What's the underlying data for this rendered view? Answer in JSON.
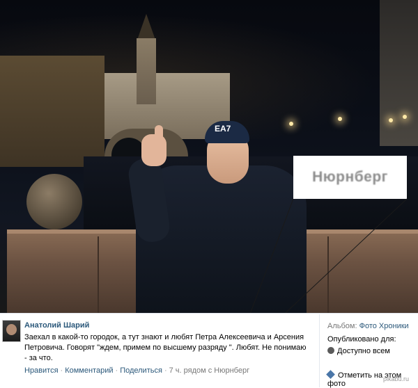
{
  "photo": {
    "caption_box": "Нюрнберг",
    "cap_logo": "EA7"
  },
  "post": {
    "author": "Анатолий Шарий",
    "text": "Заехал в какой-то городок, а тут знают и любят Петра Алексеевича и Арсения Петровича. Говорят \"ждем, примем по высшему разряду \". Любят. Не понимаю - за что.",
    "actions": {
      "like": "Нравится",
      "comment": "Комментарий",
      "share": "Поделиться",
      "meta": "7 ч. рядом с Нюрнберг"
    }
  },
  "sidebar": {
    "album_label": "Альбом:",
    "album_value": "Фото Хроники",
    "published_label": "Опубликовано для:",
    "published_value": "Доступно всем",
    "tag_link": "Отметить на этом фото"
  },
  "watermark": "pikabu.ru",
  "colors": {
    "link": "#2b587a",
    "muted": "#777777"
  }
}
